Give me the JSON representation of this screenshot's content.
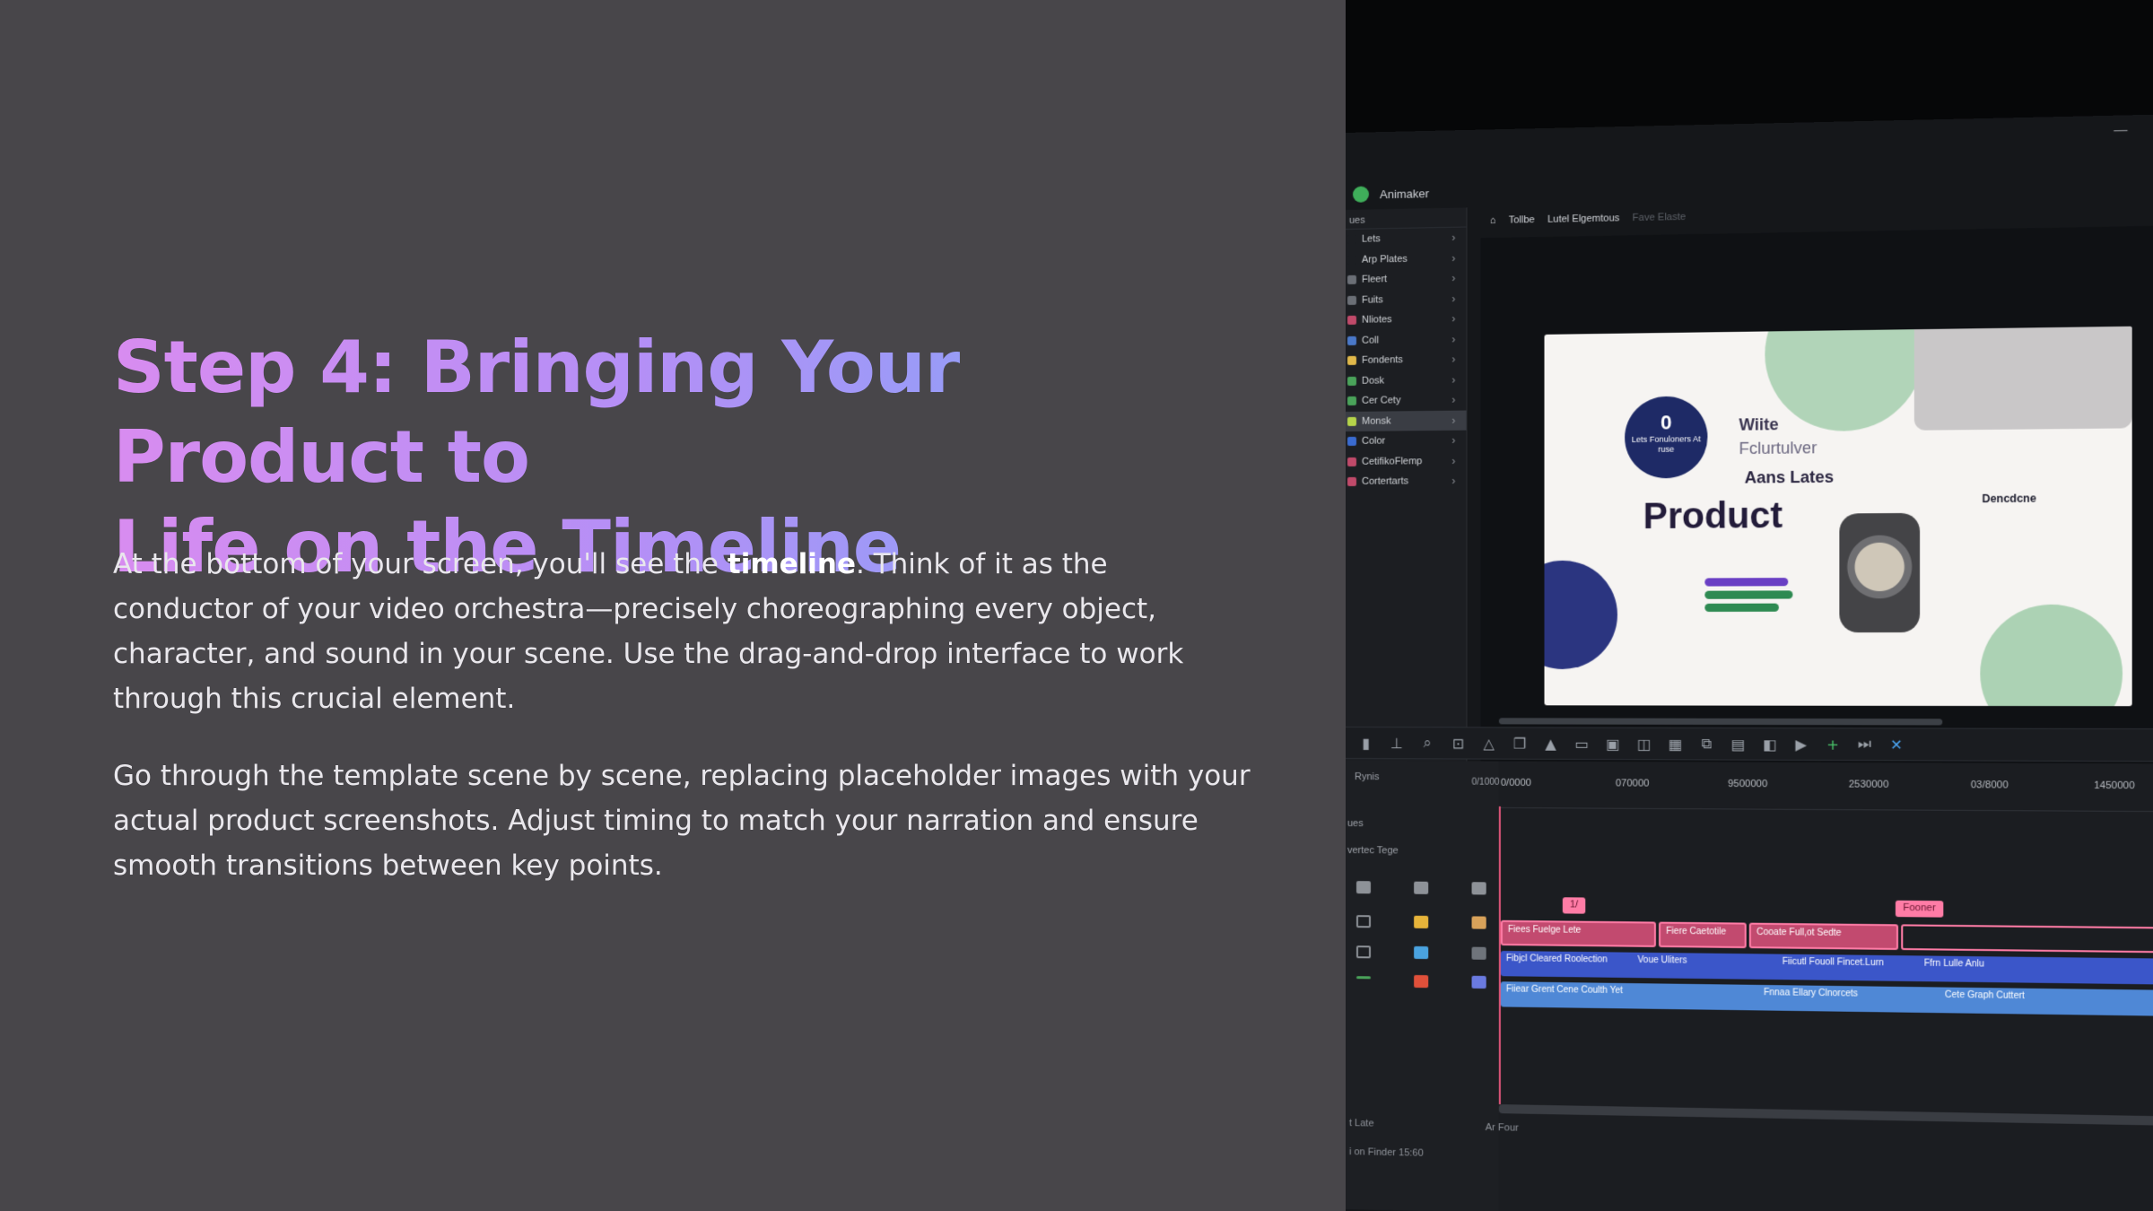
{
  "heading": {
    "line1": "Step 4: Bringing Your Product to",
    "line2": "Life on the Timeline"
  },
  "paragraph1": {
    "before": "At the bottom of your screen, you'll see the ",
    "bold": "timeline",
    "after": ". Think of it as the conductor of your video orchestra—precisely choreographing every object, character, and sound in your scene. Use the drag-and-drop interface to work through this crucial element."
  },
  "paragraph2": "Go through the template scene by scene, replacing placeholder images with your actual product screenshots. Adjust timing to match your narration and ensure smooth transitions between key points.",
  "app": {
    "name": "Animaker",
    "tabs": [
      "Tollbe",
      "Lutel Elgemtous",
      "Fave Elaste"
    ],
    "sidebar_header": "ues",
    "sidebar_items": [
      {
        "label": "Lets",
        "color": "#1c1e22"
      },
      {
        "label": "Arp Plates",
        "color": "#1c1e22"
      },
      {
        "label": "Fleert",
        "color": "#6b6f76"
      },
      {
        "label": "Fuits",
        "color": "#6b6f76"
      },
      {
        "label": "Nliotes",
        "color": "#c04a6a"
      },
      {
        "label": "Coll",
        "color": "#4a78c8"
      },
      {
        "label": "Fondents",
        "color": "#e0b84a"
      },
      {
        "label": "Dosk",
        "color": "#4aa35a"
      },
      {
        "label": "Cer Cety",
        "color": "#4aa35a"
      },
      {
        "label": "Monsk",
        "color": "#b6d44a"
      },
      {
        "label": "Color",
        "color": "#3a6bd0"
      },
      {
        "label": "CetifikoFlemp",
        "color": "#c04a6a"
      },
      {
        "label": "Cortertarts",
        "color": "#c04a6a"
      }
    ],
    "active_sidebar_index": 9,
    "slide": {
      "badge_number": "0",
      "badge_text": "Lets Fonuloners At ruse",
      "line_a": "Wiite",
      "line_b": "Fclurtulver",
      "subtitle": "Aans Lates",
      "product": "Product",
      "right_title": "Dencdcne"
    },
    "timeline": {
      "top_label": "Rynis",
      "label_ues": "ues",
      "label_range": "vertec Tege",
      "ruler_start": "0/1000",
      "ticks": [
        "0/0000",
        "070000",
        "9500000",
        "2530000",
        "03/8000",
        "1450000"
      ],
      "marker_a": "1/",
      "marker_b": "Fooner",
      "pink_tracks": [
        "Fiees Fuelge Lete",
        "Fiere Caetotile",
        "Cooate Full,ot Sedte"
      ],
      "blue_track_1": [
        "Fibjcl Cleared Roolection",
        "Voue Uliters",
        "Fiicutl Fouoll Fincet.Lurn",
        "Ffrn Lulle Anlu"
      ],
      "blue_track_2": [
        "Fiiear Grent Cene Coulth Yet",
        "Fnnaa Ellary Clnorcets",
        "Cete Graph Cuttert"
      ],
      "footer_a": "t Late",
      "footer_b": "Ar Four",
      "footer_c": "i on Finder 15:60"
    }
  },
  "colors": {
    "background": "#48464a",
    "title_gradient_start": "#d88cf0",
    "title_gradient_end": "#7da8f8",
    "body_text": "#e9e7ec",
    "timeline_pink": "#ff7ca6",
    "timeline_blue": "#3b56c9"
  }
}
